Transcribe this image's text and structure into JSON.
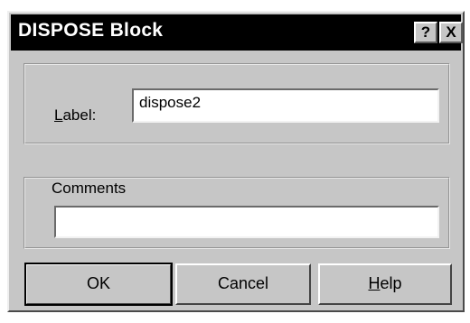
{
  "window": {
    "title": "DISPOSE Block",
    "help_glyph": "?",
    "close_glyph": "X"
  },
  "label_group": {
    "label_accel": "L",
    "label_rest": "abel:",
    "value": "dispose2"
  },
  "comments_group": {
    "legend": "Comments",
    "value": ""
  },
  "buttons": {
    "ok": "OK",
    "cancel": "Cancel",
    "help_accel": "H",
    "help_rest": "elp"
  }
}
